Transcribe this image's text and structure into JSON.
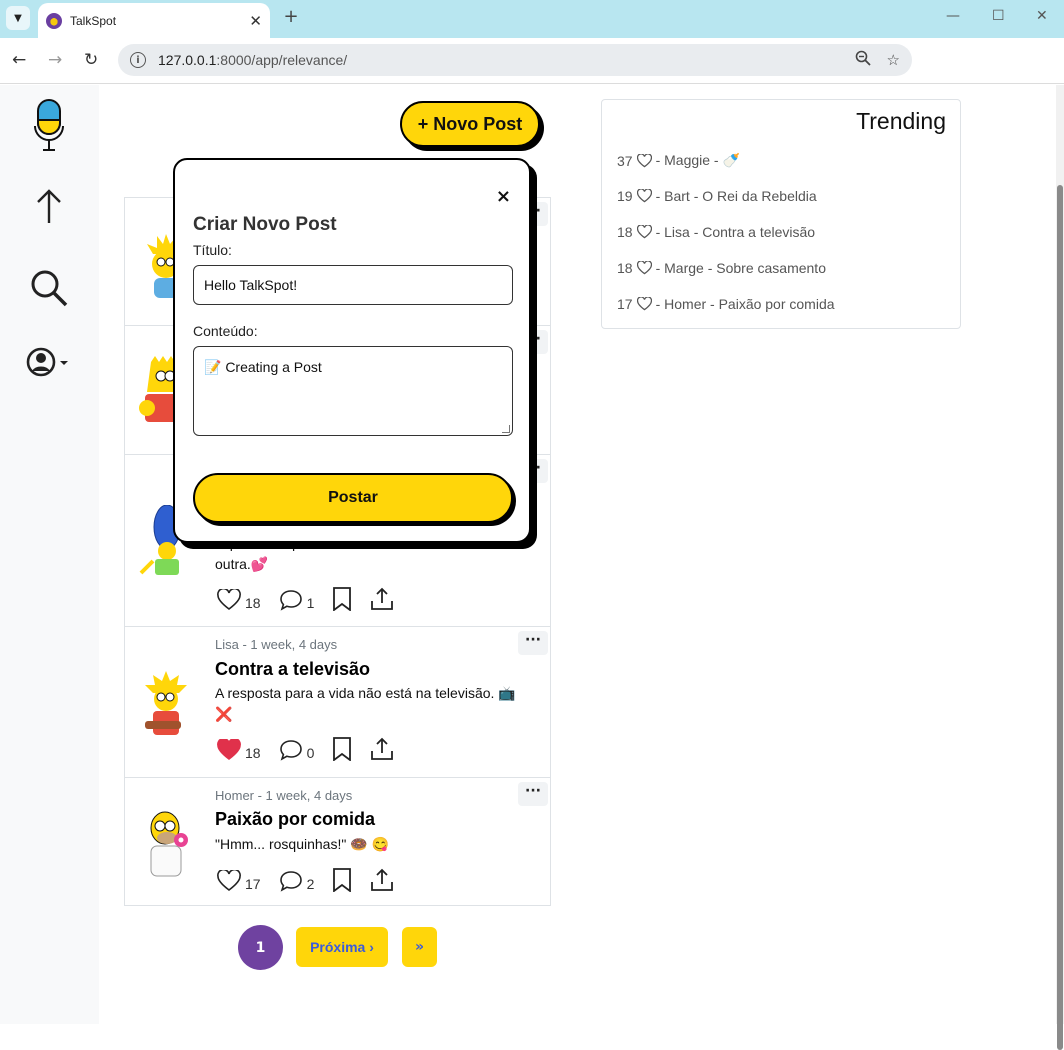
{
  "browser": {
    "tab_title": "TalkSpot",
    "url_host": "127.0.0.1",
    "url_rest": ":8000/app/relevance/"
  },
  "header": {
    "new_post_label": "+ Novo Post"
  },
  "modal": {
    "title": "Criar Novo Post",
    "title_label": "Título:",
    "title_value": "Hello TalkSpot!",
    "content_label": "Conteúdo:",
    "content_value": "📝 Creating a Post",
    "submit_label": "Postar",
    "close_label": "×"
  },
  "feed": {
    "posts": [
      {
        "author_time": "",
        "title": "",
        "body": "",
        "likes": "",
        "comments": ""
      },
      {
        "author_time": "",
        "title": "",
        "body": "",
        "likes": "",
        "comments": ""
      },
      {
        "author_time": "",
        "title": "",
        "body": "imperfeitas que se recusam a desistir uma da outra.💕",
        "likes": "18",
        "comments": "1"
      },
      {
        "author_time": "Lisa - 1 week, 4 days",
        "title": "Contra a televisão",
        "body": "A resposta para a vida não está na televisão. 📺 ❌",
        "likes": "18",
        "comments": "0",
        "liked": true
      },
      {
        "author_time": "Homer - 1 week, 4 days",
        "title": "Paixão por comida",
        "body": "\"Hmm... rosquinhas!\" 🍩 😋",
        "likes": "17",
        "comments": "2"
      }
    ]
  },
  "pagination": {
    "current": "1",
    "next_label": "Próxima ›",
    "last_label": "»"
  },
  "trending": {
    "title": "Trending",
    "items": [
      {
        "count": "37",
        "text": "- Maggie - 🍼"
      },
      {
        "count": "19",
        "text": "- Bart - O Rei da Rebeldia"
      },
      {
        "count": "18",
        "text": "- Lisa - Contra a televisão"
      },
      {
        "count": "18",
        "text": "- Marge - Sobre casamento"
      },
      {
        "count": "17",
        "text": "- Homer - Paixão por comida"
      }
    ]
  },
  "colors": {
    "accent_yellow": "#ffd60a",
    "pagination_purple": "#6f42a0",
    "like_red": "#e0314b"
  }
}
